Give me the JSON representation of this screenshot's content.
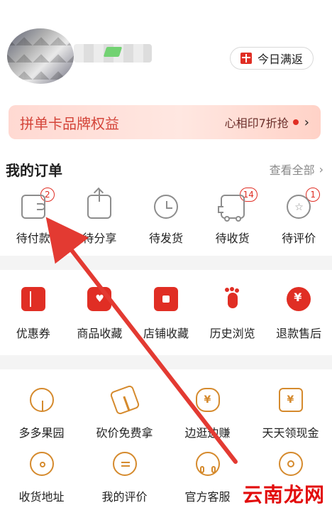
{
  "header": {
    "today_button_label": "今日满返"
  },
  "banner": {
    "title": "拼单卡品牌权益",
    "right_text": "心相印7折抢"
  },
  "orders": {
    "title": "我的订单",
    "view_all": "查看全部",
    "items": [
      {
        "label": "待付款",
        "badge": "2",
        "icon": "wallet-icon"
      },
      {
        "label": "待分享",
        "badge": "",
        "icon": "share-icon"
      },
      {
        "label": "待发货",
        "badge": "",
        "icon": "clock-icon"
      },
      {
        "label": "待收货",
        "badge": "14",
        "icon": "truck-icon"
      },
      {
        "label": "待评价",
        "badge": "1",
        "icon": "review-icon"
      }
    ]
  },
  "services": {
    "items": [
      {
        "label": "优惠券",
        "icon": "coupon-icon"
      },
      {
        "label": "商品收藏",
        "icon": "heart-bag-icon"
      },
      {
        "label": "店铺收藏",
        "icon": "store-icon"
      },
      {
        "label": "历史浏览",
        "icon": "footprint-icon"
      },
      {
        "label": "退款售后",
        "icon": "refund-icon"
      }
    ]
  },
  "tools": {
    "items": [
      {
        "label": "多多果园",
        "icon": "tree-icon"
      },
      {
        "label": "砍价免费拿",
        "icon": "axe-icon"
      },
      {
        "label": "边逛边赚",
        "icon": "money-bag-icon"
      },
      {
        "label": "天天领现金",
        "icon": "cash-icon"
      },
      {
        "label": "收货地址",
        "icon": "location-icon"
      },
      {
        "label": "我的评价",
        "icon": "chat-icon"
      },
      {
        "label": "官方客服",
        "icon": "headset-icon"
      },
      {
        "label": "",
        "icon": "settings-icon"
      }
    ]
  },
  "watermark": "云南龙网",
  "colors": {
    "accent": "#e02e24",
    "badge": "#e02e24",
    "tool_icon": "#d58a2d"
  }
}
